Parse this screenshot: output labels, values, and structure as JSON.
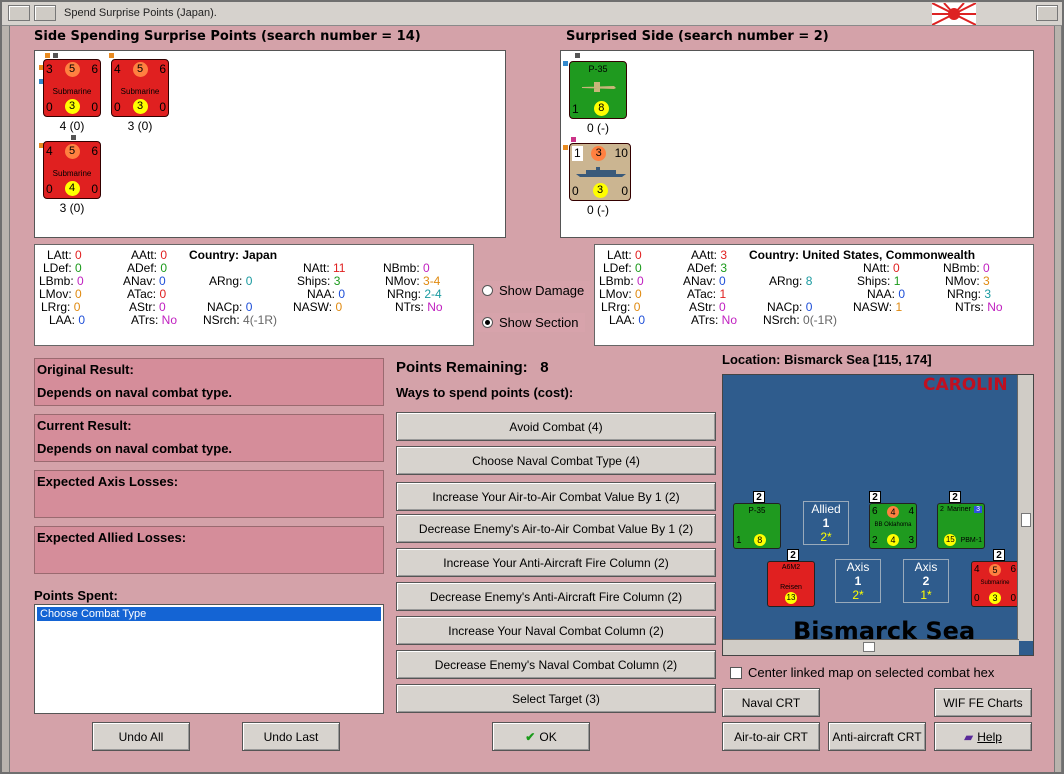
{
  "window": {
    "title": "Spend Surprise Points (Japan)."
  },
  "spending_side": {
    "heading": "Side Spending Surprise Points (search number = 14)",
    "units": [
      {
        "top": [
          "3",
          "5",
          "6"
        ],
        "name": "Submarine",
        "bot": [
          "0",
          "3",
          "0"
        ],
        "caption": "4 (0)"
      },
      {
        "top": [
          "4",
          "5",
          "6"
        ],
        "name": "Submarine",
        "bot": [
          "0",
          "3",
          "0"
        ],
        "caption": "3 (0)"
      },
      {
        "top": [
          "4",
          "5",
          "6"
        ],
        "name": "Submarine",
        "bot": [
          "0",
          "4",
          "0"
        ],
        "caption": "3 (0)"
      }
    ]
  },
  "surprised_side": {
    "heading": "Surprised Side (search number = 2)",
    "units": [
      {
        "top": [
          "",
          "P-35",
          ""
        ],
        "name": "",
        "bot": [
          "1",
          "8",
          ""
        ],
        "caption": "0 (-)"
      },
      {
        "top": [
          "1",
          "3",
          "10"
        ],
        "name": "",
        "bot": [
          "0",
          "3",
          "0"
        ],
        "caption": "0 (-)"
      }
    ]
  },
  "stats_left": {
    "country_label": "Country:",
    "country": "Japan",
    "LAtt": "0",
    "LDef": "0",
    "LBmb": "0",
    "LMov": "0",
    "LRrg": "0",
    "LAA": "0",
    "AAtt": "0",
    "ADef": "0",
    "ANav": "0",
    "ATac": "0",
    "AStr": "0",
    "ATrs": "No",
    "ARng": "0",
    "NACp": "0",
    "NSrch": "4(-1R)",
    "NAtt": "11",
    "Ships": "3",
    "NAA": "0",
    "NASW": "0",
    "NBmb": "0",
    "NMov": "3-4",
    "NRng": "2-4",
    "NTrs": "No"
  },
  "stats_right": {
    "country_label": "Country:",
    "country": "United States, Commonwealth",
    "LAtt": "0",
    "LDef": "0",
    "LBmb": "0",
    "LMov": "0",
    "LRrg": "0",
    "LAA": "0",
    "AAtt": "3",
    "ADef": "3",
    "ANav": "0",
    "ATac": "1",
    "AStr": "0",
    "ATrs": "No",
    "ARng": "8",
    "NACp": "0",
    "NSrch": "0(-1R)",
    "NAtt": "0",
    "Ships": "1",
    "NAA": "0",
    "NASW": "1",
    "NBmb": "0",
    "NMov": "3",
    "NRng": "3",
    "NTrs": "No"
  },
  "options": {
    "show_damage": "Show Damage",
    "show_section": "Show Section"
  },
  "results": {
    "original_label": "Original Result:",
    "original_value": "Depends on naval combat type.",
    "current_label": "Current Result:",
    "current_value": "Depends on naval combat type.",
    "axis_losses_label": "Expected Axis Losses:",
    "allied_losses_label": "Expected Allied Losses:"
  },
  "points_spent": {
    "label": "Points Spent:",
    "items": [
      "Choose Combat Type"
    ]
  },
  "points_remaining": {
    "label": "Points Remaining:",
    "value": "8"
  },
  "ways_label": "Ways to spend points (cost):",
  "actions": [
    "Avoid Combat (4)",
    "Choose Naval Combat Type (4)",
    "Increase Your Air-to-Air Combat Value By 1 (2)",
    "Decrease Enemy's Air-to-Air Combat Value By 1 (2)",
    "Increase Your Anti-Aircraft Fire Column (2)",
    "Decrease Enemy's Anti-Aircraft Fire Column (2)",
    "Increase Your Naval Combat Column (2)",
    "Decrease Enemy's Naval Combat Column (2)",
    "Select Target (3)"
  ],
  "location": {
    "label": "Location: Bismarck Sea [115, 174]"
  },
  "map": {
    "region_top": "CAROLIN",
    "sea_name": "Bismarck Sea",
    "allied_box": {
      "title": "Allied",
      "num": "1",
      "sub": "2*"
    },
    "axis1": {
      "title": "Axis",
      "num": "1",
      "sub": "2*"
    },
    "axis2": {
      "title": "Axis",
      "num": "2",
      "sub": "1*"
    },
    "stacks": [
      "2",
      "2",
      "2",
      "2",
      "2"
    ],
    "counters": [
      {
        "top": [
          "",
          "P-35",
          ""
        ],
        "mid": "",
        "bot": [
          "1",
          "8",
          ""
        ]
      },
      {
        "top": [
          "6",
          "4",
          "4"
        ],
        "mid": "BB Oklahoma",
        "bot": [
          "2",
          "4",
          "3"
        ]
      },
      {
        "top": [
          "2",
          "Mariner",
          "3"
        ],
        "mid": "PBM-1",
        "bot": [
          "",
          "15",
          ""
        ]
      },
      {
        "top": [
          "",
          "A6M2",
          ""
        ],
        "mid": "Reisen",
        "bot": [
          "",
          "13",
          ""
        ]
      },
      {
        "top": [
          "4",
          "5",
          "6"
        ],
        "mid": "Submarine",
        "bot": [
          "0",
          "3",
          "0"
        ]
      }
    ]
  },
  "center_map_label": "Center linked map on selected combat hex",
  "buttons": {
    "undo_all": "Undo All",
    "undo_last": "Undo Last",
    "ok": "OK",
    "naval_crt": "Naval CRT",
    "wif_fe_charts": "WIF FE Charts",
    "air_crt": "Air-to-air CRT",
    "aa_crt": "Anti-aircraft CRT",
    "help": "Help"
  },
  "colors": {
    "background": "#d4a2a9",
    "result_box": "#d58d9a",
    "map_sea": "#2f5c8d",
    "axis_counter": "#e02020",
    "allied_counter": "#1f9a1f"
  }
}
